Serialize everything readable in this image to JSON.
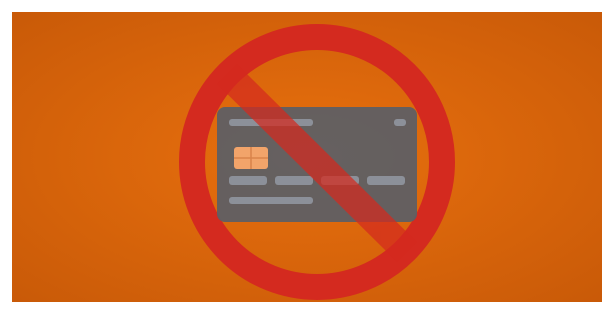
{
  "illustration": {
    "subject": "credit-card",
    "overlay": "prohibition-sign",
    "colors": {
      "background": "#e8700e",
      "background_edge": "#c95a08",
      "prohibition": "#d42a1f",
      "card_body": "#5b5f66",
      "card_shade": "#4a4d53",
      "card_lines": "#8c9099",
      "chip": "#f2a46a"
    }
  }
}
